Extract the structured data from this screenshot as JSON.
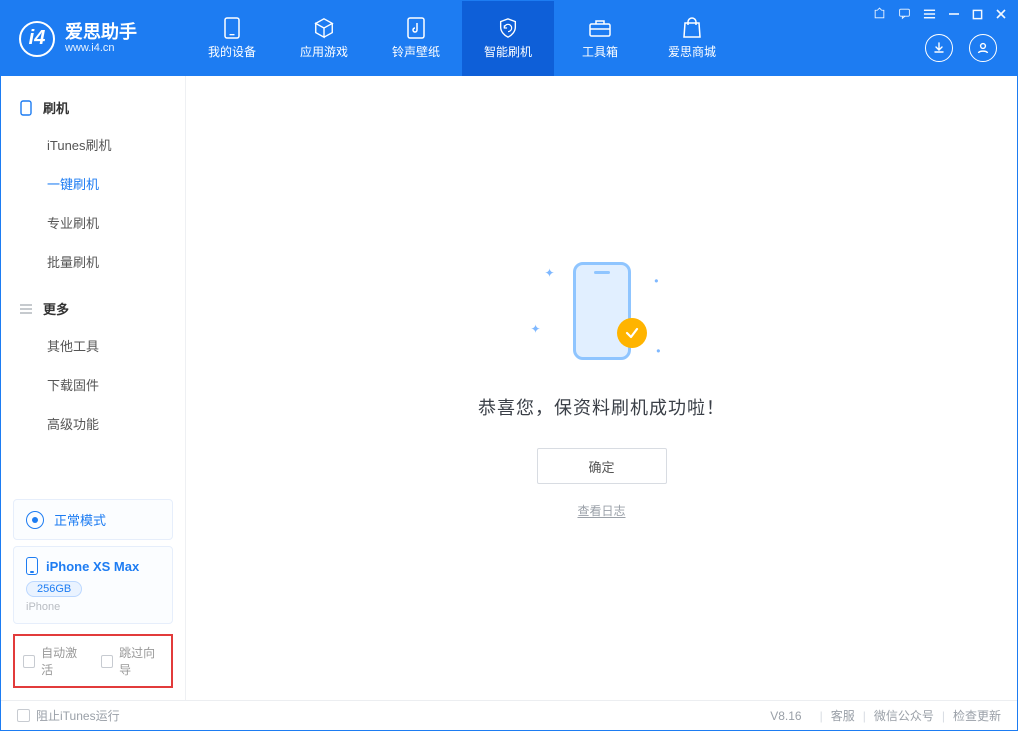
{
  "app": {
    "name": "爱思助手",
    "subtitle": "www.i4.cn"
  },
  "tabs": [
    {
      "label": "我的设备",
      "icon": "device"
    },
    {
      "label": "应用游戏",
      "icon": "cube"
    },
    {
      "label": "铃声壁纸",
      "icon": "music"
    },
    {
      "label": "智能刷机",
      "icon": "shield",
      "active": true
    },
    {
      "label": "工具箱",
      "icon": "toolbox"
    },
    {
      "label": "爱思商城",
      "icon": "bag"
    }
  ],
  "sidebar": {
    "groups": [
      {
        "title": "刷机",
        "icon": "phone",
        "items": [
          {
            "label": "iTunes刷机"
          },
          {
            "label": "一键刷机",
            "active": true
          },
          {
            "label": "专业刷机"
          },
          {
            "label": "批量刷机"
          }
        ]
      },
      {
        "title": "更多",
        "icon": "list",
        "items": [
          {
            "label": "其他工具"
          },
          {
            "label": "下载固件"
          },
          {
            "label": "高级功能"
          }
        ]
      }
    ],
    "status": {
      "label": "正常模式"
    },
    "device": {
      "name": "iPhone XS Max",
      "capacity": "256GB",
      "type": "iPhone"
    },
    "options": {
      "auto_activate": "自动激活",
      "skip_guide": "跳过向导"
    }
  },
  "main": {
    "success_message": "恭喜您，保资料刷机成功啦！",
    "confirm": "确定",
    "view_log": "查看日志"
  },
  "footer": {
    "block_itunes": "阻止iTunes运行",
    "version": "V8.16",
    "links": [
      "客服",
      "微信公众号",
      "检查更新"
    ]
  }
}
